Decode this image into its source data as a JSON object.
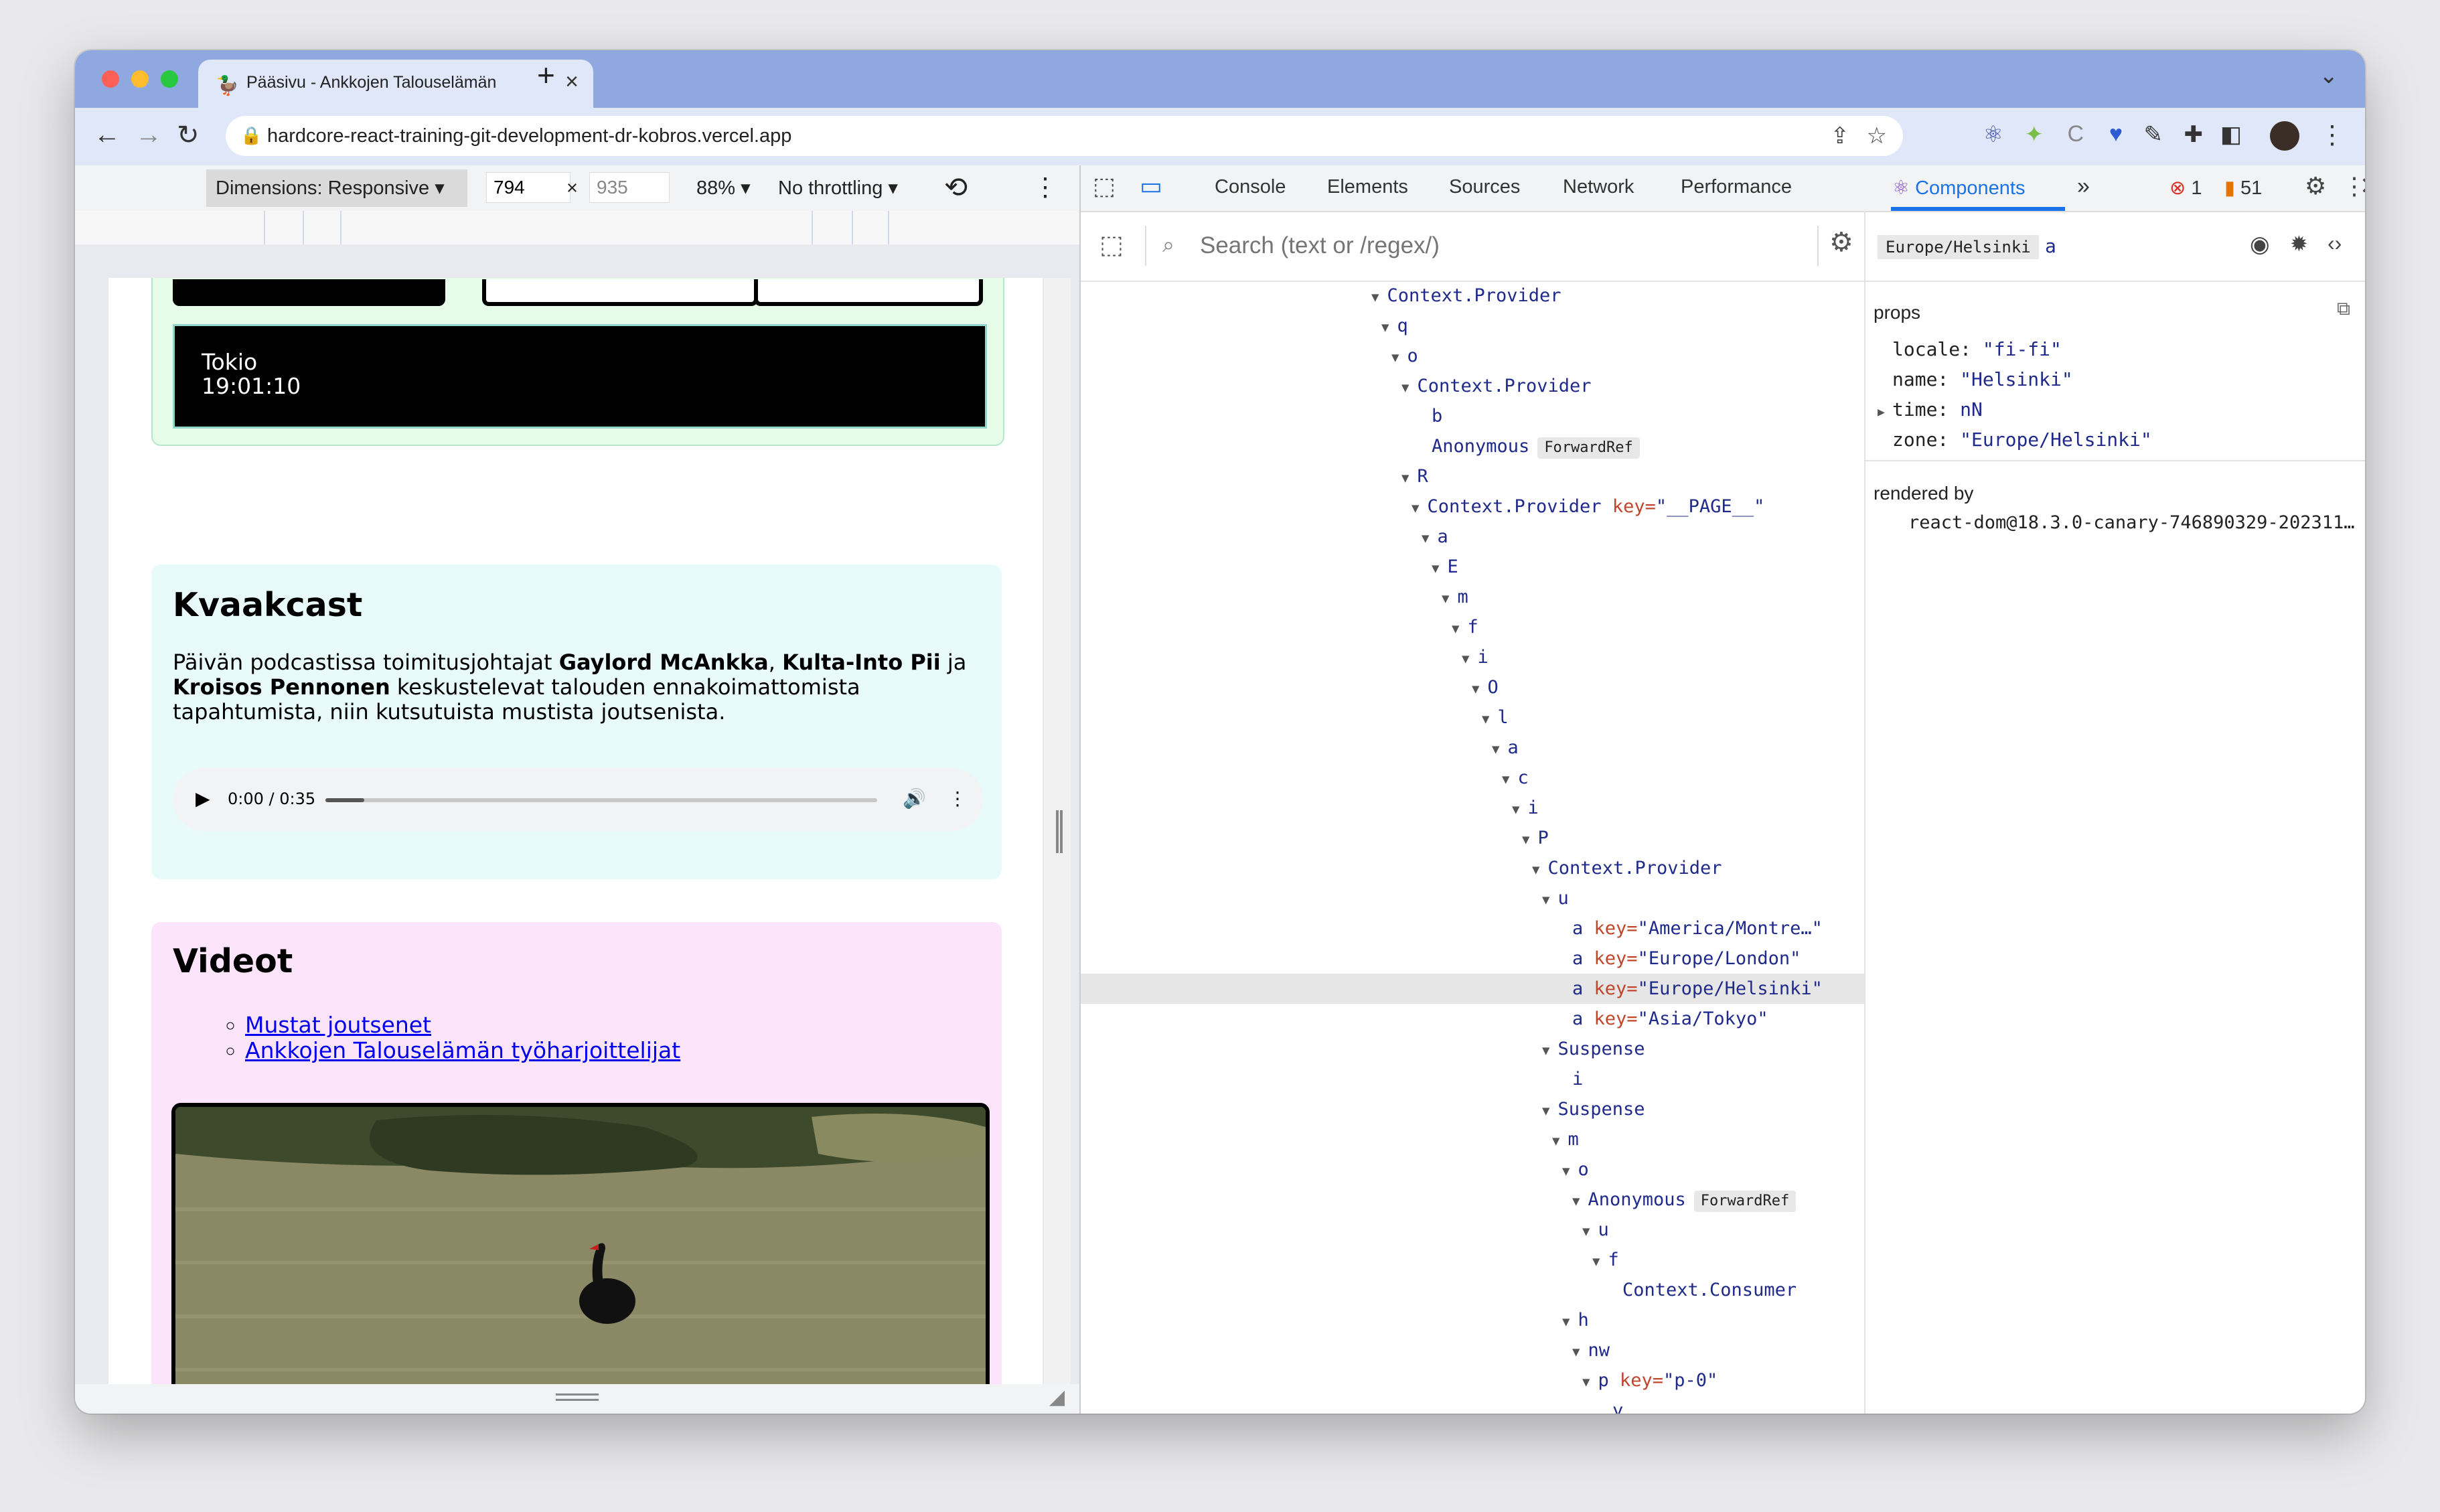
{
  "browser": {
    "tab_title": "Pääsivu - Ankkojen Talouselämän",
    "url": "hardcore-react-training-git-development-dr-kobros.vercel.app"
  },
  "device_toolbar": {
    "dimensions": "Dimensions: Responsive",
    "width": "794",
    "x": "×",
    "height": "935",
    "zoom": "88%",
    "throttling": "No throttling"
  },
  "page": {
    "clock": {
      "city": "Tokio",
      "time": "19:01:10"
    },
    "kvaakcast": {
      "title": "Kvaakcast",
      "p1": "Päivän podcastissa toimitusjohtajat ",
      "b1": "Gaylord McAnkka",
      "p2": ", ",
      "b2": "Kulta-Into Pii",
      "p3": " ja ",
      "b3": "Kroisos Pennonen",
      "p4": " keskustelevat talouden ennakoimattomista tapahtumista, niin kutsutuista mustista joutsenista.",
      "player_time": "0:00 / 0:35",
      "progress": 0.07
    },
    "videot": {
      "title": "Videot",
      "links": [
        "Mustat joutsenet",
        "Ankkojen Talouselämän työharjoittelijat"
      ]
    }
  },
  "devtools": {
    "tabs": [
      "Console",
      "Elements",
      "Sources",
      "Network",
      "Performance",
      "Components"
    ],
    "errors": "1",
    "warnings": "51",
    "search_placeholder": "Search (text or /regex/)",
    "breadcrumb": "Europe/Helsinki",
    "selected_name": "a",
    "props_label": "props",
    "props": [
      {
        "name": "locale:",
        "value": "\"fi-fi\""
      },
      {
        "name": "name:",
        "value": "\"Helsinki\""
      },
      {
        "name": "time:",
        "value": "nN"
      },
      {
        "name": "zone:",
        "value": "\"Europe/Helsinki\""
      }
    ],
    "rendered_by_label": "rendered by",
    "rendered_by": "react-dom@18.3.0-canary-746890329-202311…",
    "tree": [
      {
        "t": "Context.Provider",
        "k": "",
        "v": "",
        "b": ""
      },
      {
        "t": "q",
        "k": "",
        "v": "",
        "b": ""
      },
      {
        "t": "o",
        "k": "",
        "v": "",
        "b": ""
      },
      {
        "t": "Context.Provider",
        "k": "",
        "v": "",
        "b": ""
      },
      {
        "t": "b",
        "k": "",
        "v": "",
        "b": ""
      },
      {
        "t": "Anonymous",
        "k": "",
        "v": "",
        "b": "ForwardRef"
      },
      {
        "t": "R",
        "k": "",
        "v": "",
        "b": ""
      },
      {
        "t": "Context.Provider",
        "k": "key=",
        "v": "\"__PAGE__\"",
        "b": ""
      },
      {
        "t": "a",
        "k": "",
        "v": "",
        "b": ""
      },
      {
        "t": "E",
        "k": "",
        "v": "",
        "b": ""
      },
      {
        "t": "m",
        "k": "",
        "v": "",
        "b": ""
      },
      {
        "t": "f",
        "k": "",
        "v": "",
        "b": ""
      },
      {
        "t": "i",
        "k": "",
        "v": "",
        "b": ""
      },
      {
        "t": "O",
        "k": "",
        "v": "",
        "b": ""
      },
      {
        "t": "l",
        "k": "",
        "v": "",
        "b": ""
      },
      {
        "t": "a",
        "k": "",
        "v": "",
        "b": ""
      },
      {
        "t": "c",
        "k": "",
        "v": "",
        "b": ""
      },
      {
        "t": "i",
        "k": "",
        "v": "",
        "b": ""
      },
      {
        "t": "P",
        "k": "",
        "v": "",
        "b": ""
      },
      {
        "t": "Context.Provider",
        "k": "",
        "v": "",
        "b": ""
      },
      {
        "t": "u",
        "k": "",
        "v": "",
        "b": ""
      },
      {
        "t": "a",
        "k": "key=",
        "v": "\"America/Montre…\"",
        "b": ""
      },
      {
        "t": "a",
        "k": "key=",
        "v": "\"Europe/London\"",
        "b": ""
      },
      {
        "t": "a",
        "k": "key=",
        "v": "\"Europe/Helsinki\"",
        "b": ""
      },
      {
        "t": "a",
        "k": "key=",
        "v": "\"Asia/Tokyo\"",
        "b": ""
      },
      {
        "t": "Suspense",
        "k": "",
        "v": "",
        "b": ""
      },
      {
        "t": "i",
        "k": "",
        "v": "",
        "b": ""
      },
      {
        "t": "Suspense",
        "k": "",
        "v": "",
        "b": ""
      },
      {
        "t": "m",
        "k": "",
        "v": "",
        "b": ""
      },
      {
        "t": "o",
        "k": "",
        "v": "",
        "b": ""
      },
      {
        "t": "Anonymous",
        "k": "",
        "v": "",
        "b": "ForwardRef"
      },
      {
        "t": "u",
        "k": "",
        "v": "",
        "b": ""
      },
      {
        "t": "f",
        "k": "",
        "v": "",
        "b": ""
      },
      {
        "t": "Context.Consumer",
        "k": "",
        "v": "",
        "b": ""
      },
      {
        "t": "h",
        "k": "",
        "v": "",
        "b": ""
      },
      {
        "t": "nw",
        "k": "",
        "v": "",
        "b": ""
      },
      {
        "t": "p",
        "k": "key=",
        "v": "\"p-0\"",
        "b": ""
      },
      {
        "t": "y",
        "k": "",
        "v": "",
        "b": ""
      }
    ]
  }
}
